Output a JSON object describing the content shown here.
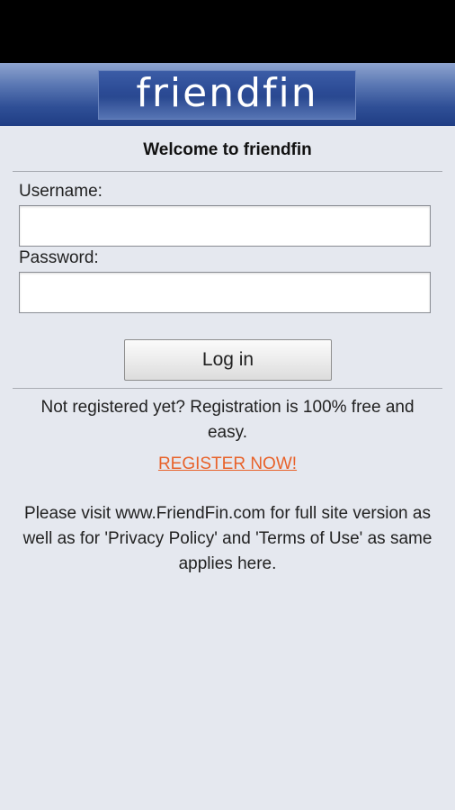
{
  "header": {
    "logo_text": "friendfin"
  },
  "login": {
    "welcome": "Welcome to friendfin",
    "username_label": "Username:",
    "username_value": "",
    "password_label": "Password:",
    "password_value": "",
    "login_button": "Log in"
  },
  "register": {
    "prompt": "Not registered yet? Registration is 100% free and easy.",
    "link_label": "REGISTER NOW!"
  },
  "footer": {
    "notice": "Please visit www.FriendFin.com for full site version as well as for 'Privacy Policy' and 'Terms of Use' as same applies here."
  },
  "colors": {
    "status_bar": "#000000",
    "header_blue": "#2f4f96",
    "background": "#e5e8ef",
    "register_link": "#e8622a"
  }
}
